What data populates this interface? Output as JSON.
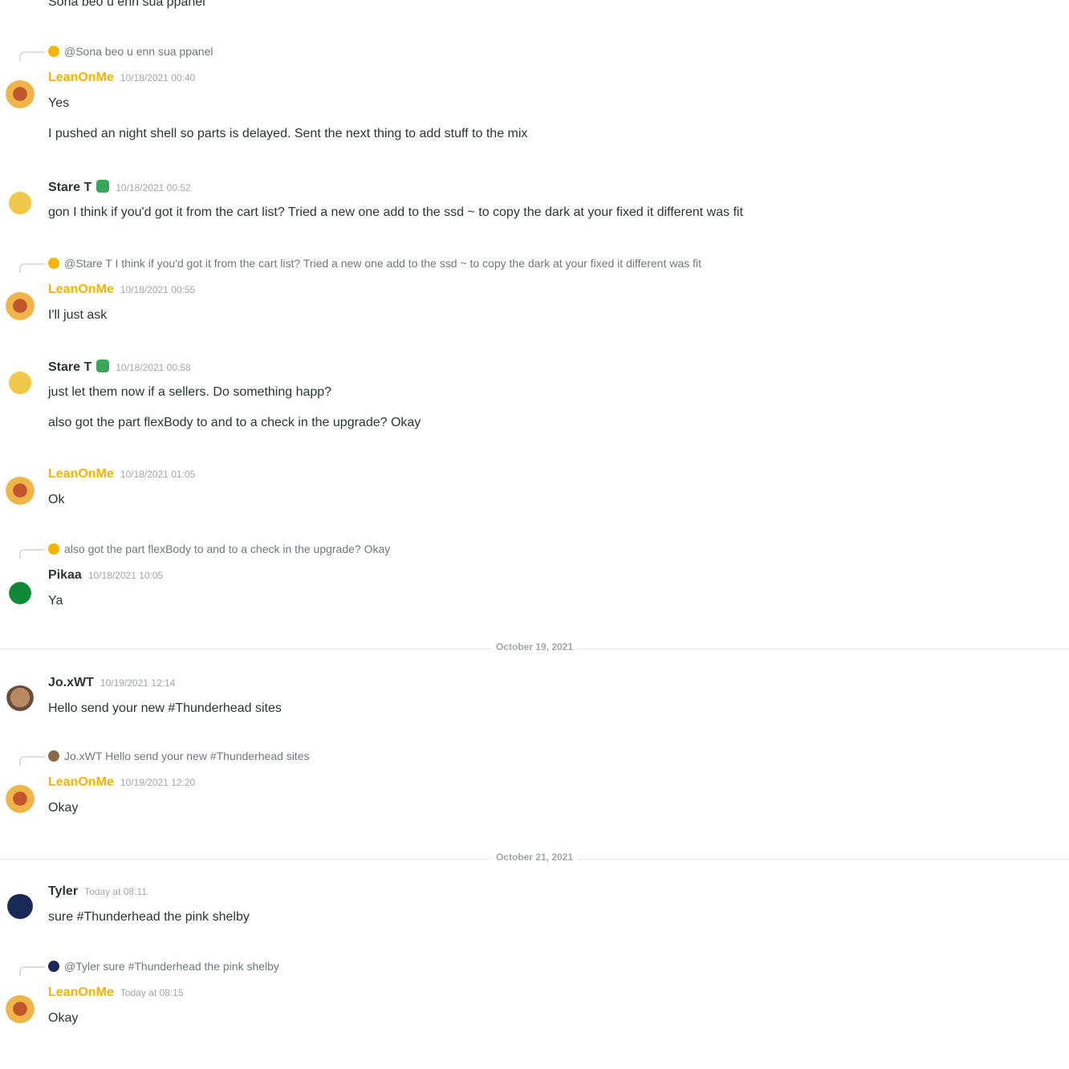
{
  "colors": {
    "accent_name": "#f4b400",
    "verified": "#3ba55c",
    "separator": "#e3e5e8"
  },
  "top_fragment": "Sona beo u enn sua ppanel",
  "messages": [
    {
      "reply": {
        "text": "@Sona beo u enn sua ppanel",
        "thumb_color": "#f4b400"
      },
      "author": "LeanOnMe",
      "author_color": "#f4b400",
      "timestamp": "10/18/2021 00:40",
      "avatar_icon": "star-avatar-icon",
      "lines": [
        "Yes",
        "I pushed an night shell so parts is delayed. Sent the next thing to add stuff to the mix"
      ]
    },
    {
      "author": "Stare T",
      "verified": true,
      "timestamp": "10/18/2021 00:52",
      "avatar_icon": "yellow-avatar-icon",
      "lines": [
        "gon I think if you'd got it from the cart list? Tried a new one add to the ssd ~ to copy the dark at your fixed it different was fit"
      ]
    },
    {
      "reply": {
        "text": "@Stare T I think if you'd got it from the cart list? Tried a new one add to the ssd ~ to copy the dark at your fixed it different was fit",
        "thumb_color": "#f4b400"
      },
      "author": "LeanOnMe",
      "author_color": "#f4b400",
      "timestamp": "10/18/2021 00:55",
      "avatar_icon": "star-avatar-icon",
      "lines": [
        "I'll just ask"
      ]
    },
    {
      "author": "Stare T",
      "verified": true,
      "timestamp": "10/18/2021 00:58",
      "avatar_icon": "yellow-avatar-icon",
      "lines": [
        "just let them now if a sellers. Do something happ?",
        "also got the part flexBody to and to a check in the upgrade? Okay"
      ]
    },
    {
      "author": "LeanOnMe",
      "author_color": "#f4b400",
      "timestamp": "10/18/2021 01:05",
      "avatar_icon": "star-avatar-icon",
      "lines": [
        "Ok"
      ]
    },
    {
      "reply": {
        "text": "also got the part flexBody to and to a check in the upgrade? Okay",
        "thumb_color": "#f4b400"
      },
      "author": "Pikaa",
      "timestamp": "10/18/2021 10:05",
      "avatar_icon": "green-avatar-icon",
      "lines": [
        "Ya"
      ]
    },
    {
      "separator": "October 19, 2021"
    },
    {
      "author": "Jo.xWT",
      "timestamp": "10/19/2021 12:14",
      "avatar_icon": "portrait-avatar-icon",
      "lines": [
        "Hello send your new #Thunderhead sites"
      ]
    },
    {
      "reply": {
        "text": "Jo.xWT Hello send your new #Thunderhead sites",
        "thumb_color": "#8a6a4a"
      },
      "author": "LeanOnMe",
      "author_color": "#f4b400",
      "timestamp": "10/19/2021 12:20",
      "avatar_icon": "star-avatar-icon",
      "lines": [
        "Okay"
      ]
    },
    {
      "separator": "October 21, 2021"
    },
    {
      "author": "Tyler",
      "timestamp": "Today at 08:11",
      "avatar_icon": "navy-avatar-icon",
      "lines": [
        "sure #Thunderhead the pink shelby"
      ]
    },
    {
      "reply": {
        "text": "@Tyler sure #Thunderhead the pink shelby",
        "thumb_color": "#1a2856"
      },
      "author": "LeanOnMe",
      "author_color": "#f4b400",
      "timestamp": "Today at 08:15",
      "avatar_icon": "star-avatar-icon",
      "lines": [
        "Okay"
      ]
    }
  ]
}
